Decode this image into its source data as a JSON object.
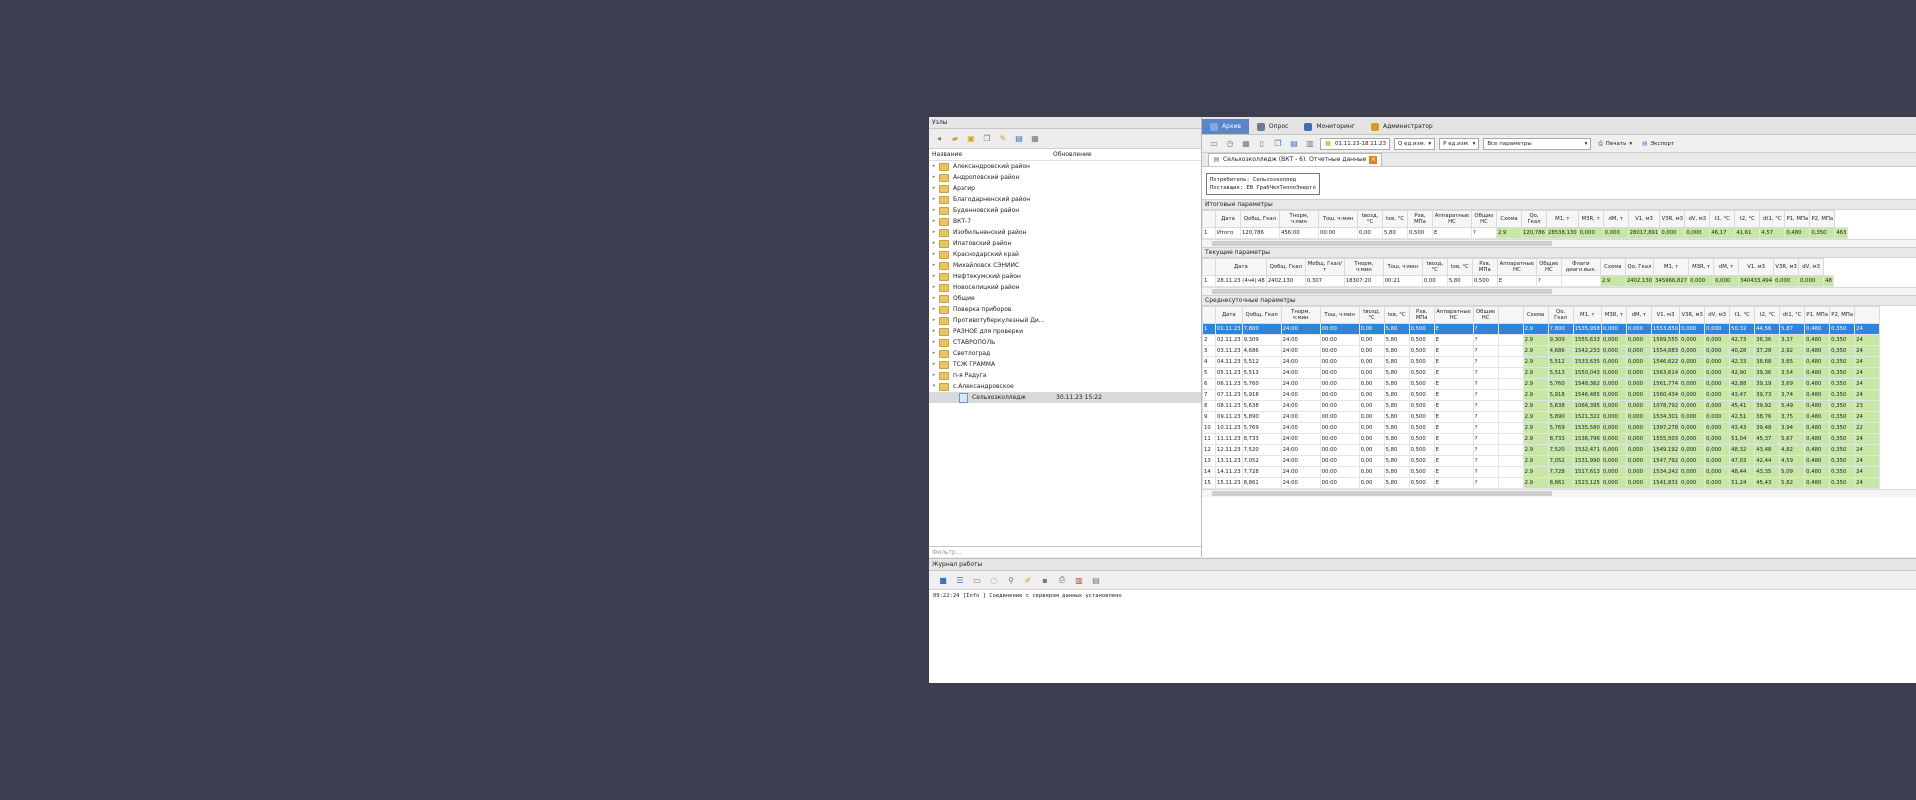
{
  "left_panel": {
    "title": "Узлы",
    "col_name": "Название",
    "col_updated": "Обновление",
    "filter_placeholder": "Фильтр...",
    "tree": [
      {
        "label": "Александровский район",
        "type": "folder",
        "expanded": false
      },
      {
        "label": "Андроповский район",
        "type": "folder",
        "expanded": false
      },
      {
        "label": "Арзгир",
        "type": "folder",
        "expanded": false
      },
      {
        "label": "Благодарненский район",
        "type": "folder",
        "expanded": false
      },
      {
        "label": "Буденновский район",
        "type": "folder",
        "expanded": false
      },
      {
        "label": "ВКТ-7",
        "type": "folder",
        "expanded": false
      },
      {
        "label": "Изобильненский район",
        "type": "folder",
        "expanded": false
      },
      {
        "label": "Ипатовский район",
        "type": "folder",
        "expanded": false
      },
      {
        "label": "Краснодарский край",
        "type": "folder",
        "expanded": false
      },
      {
        "label": "Михайловск СЭНИИС",
        "type": "folder",
        "expanded": false
      },
      {
        "label": "Нефтекумский район",
        "type": "folder",
        "expanded": false
      },
      {
        "label": "Новоселицкий район",
        "type": "folder",
        "expanded": false
      },
      {
        "label": "Общие",
        "type": "folder",
        "expanded": false
      },
      {
        "label": "Поверка приборов",
        "type": "folder",
        "expanded": false
      },
      {
        "label": "Противотуберкулезный Ди...",
        "type": "folder",
        "expanded": false
      },
      {
        "label": "РАЗНОЕ для проверки",
        "type": "folder",
        "expanded": false
      },
      {
        "label": "СТАВРОПОЛЬ",
        "type": "folder",
        "expanded": false
      },
      {
        "label": "Светлоград",
        "type": "folder",
        "expanded": false
      },
      {
        "label": "ТСЖ ГРАММА",
        "type": "folder",
        "expanded": false
      },
      {
        "label": "п-я Радуга",
        "type": "folder",
        "expanded": false
      },
      {
        "label": "с.Александровское",
        "type": "folder",
        "expanded": true
      },
      {
        "label": "Сельхозколледж",
        "type": "file",
        "updated": "30.11.23 15:22",
        "selected": true
      }
    ]
  },
  "tabs": [
    {
      "label": "Архив",
      "active": true,
      "color": "#7fa8e0"
    },
    {
      "label": "Опрос",
      "active": false,
      "color": "#6f7a8a"
    },
    {
      "label": "Мониторинг",
      "active": false,
      "color": "#3e6db3"
    },
    {
      "label": "Администратор",
      "active": false,
      "color": "#d4a017"
    }
  ],
  "toolbar": {
    "date_range": "01.11.23-18.11.23",
    "unit_q": "Q ед.изм.",
    "unit_p": "P ед.изм.",
    "params": "Все параметры",
    "print": "Печать",
    "export": "Экспорт"
  },
  "document_tab": "Сельхозколледж (ВКТ - 6). Отчетные данные",
  "info": {
    "line1": "Потребитель: Сельхозколлед",
    "line2": "Поставщик: ЕВ ГрабЧелТеплоЭнерго"
  },
  "totals": {
    "label": "Итоговые параметры",
    "headers": [
      "Дата",
      "Qобщ, Гкал",
      "Тнорм, ч:мин",
      "Тош, ч:мин",
      "tвозд, °C",
      "tхв, °C",
      "Pхв, МПа",
      "Аппаратные НС",
      "Общие НС",
      "Схема",
      "Qo, Гкал",
      "M1, т",
      "M3R, т",
      "dM, т",
      "V1, м3",
      "V3R, м3",
      "dV, м3",
      "t1, °C",
      "t2, °C",
      "dt1, °C",
      "P1, МПа",
      "P2, МПа"
    ],
    "rows": [
      [
        "1",
        "Итого",
        "120,786",
        "456:00",
        "00:00",
        "0,00",
        "5,80",
        "0,500",
        "E",
        "?",
        "2.9",
        "120,786",
        "28538,130",
        "0,000",
        "0,000",
        "28017,891",
        "0,000",
        "0,000",
        "46,17",
        "41,61",
        "4,57",
        "0,480",
        "0,350",
        "463"
      ]
    ]
  },
  "current": {
    "label": "Текущие параметры",
    "headers": [
      "Дата",
      "Qобщ, Гкал",
      "Мобщ, Гкал/т",
      "Тнорм, ч:мин",
      "Тош, ч:мин",
      "tвозд, °C",
      "tхв, °C",
      "Pхв, МПа",
      "Аппаратные НС",
      "Общие НС",
      "Флаги диагн.вых.",
      "Схема",
      "Qo, Гкал",
      "M1, т",
      "M3R, т",
      "dM, т",
      "V1, м3",
      "V3R, м3",
      "dV, м3"
    ],
    "rows": [
      [
        "1",
        "28.11.23 (4ч4):48",
        "2402,130",
        "0,307",
        "18307:20",
        "00:21",
        "0,00",
        "5,80",
        "0,500",
        "E",
        "?",
        "",
        "2.9",
        "2402,130",
        "345966,827",
        "0,000",
        "0,000",
        "340433,494",
        "0,000",
        "0,000",
        "48"
      ]
    ]
  },
  "daily": {
    "label": "Среднесуточные параметры",
    "headers": [
      "",
      "Дата",
      "Qобщ, Гкал",
      "Тнорм, ч:мин",
      "Тош, ч:мин",
      "tвозд, °C",
      "tхв, °C",
      "Pхв, МПа",
      "Аппаратные НС",
      "Общие НС",
      "",
      "Схема",
      "Qo, Гкал",
      "M1, т",
      "M3R, т",
      "dM, т",
      "V1, м3",
      "V3R, м3",
      "dV, м3",
      "t1, °C",
      "t2, °C",
      "dt1, °C",
      "P1, МПа",
      "P2, МПа",
      ""
    ],
    "rows": [
      [
        "1",
        "01.11.23",
        "7,800",
        "24:00",
        "00:00",
        "0,00",
        "5,80",
        "0,500",
        "E",
        "?",
        "",
        "2.9",
        "7,800",
        "1535,958",
        "0,000",
        "0,000",
        "1553,850",
        "0,000",
        "0,000",
        "50,32",
        "44,56",
        "5,87",
        "0,480",
        "0,350",
        "24"
      ],
      [
        "2",
        "02.11.23",
        "9,309",
        "24:00",
        "00:00",
        "0,00",
        "5,80",
        "0,500",
        "E",
        "?",
        "",
        "2.9",
        "9,309",
        "1555,633",
        "0,000",
        "0,000",
        "1569,555",
        "0,000",
        "0,000",
        "42,73",
        "36,36",
        "3,37",
        "0,480",
        "0,350",
        "24"
      ],
      [
        "3",
        "03.11.23",
        "4,686",
        "24:00",
        "00:00",
        "0,00",
        "5,80",
        "0,500",
        "E",
        "?",
        "",
        "2.9",
        "4,686",
        "1542,233",
        "0,000",
        "0,000",
        "1554,883",
        "0,000",
        "0,000",
        "40,28",
        "37,28",
        "2,92",
        "0,480",
        "0,350",
        "24"
      ],
      [
        "4",
        "04.11.23",
        "5,512",
        "24:00",
        "00:00",
        "0,00",
        "5,80",
        "0,500",
        "E",
        "?",
        "",
        "2.9",
        "5,512",
        "1533,635",
        "0,000",
        "0,000",
        "1546,622",
        "0,000",
        "0,000",
        "42,33",
        "38,68",
        "3,65",
        "0,480",
        "0,350",
        "24"
      ],
      [
        "5",
        "05.11.23",
        "5,513",
        "24:00",
        "00:00",
        "0,00",
        "5,80",
        "0,500",
        "E",
        "?",
        "",
        "2.9",
        "5,513",
        "1550,043",
        "0,000",
        "0,000",
        "1563,614",
        "0,000",
        "0,000",
        "42,90",
        "39,36",
        "3,54",
        "0,480",
        "0,350",
        "24"
      ],
      [
        "6",
        "06.11.23",
        "5,760",
        "24:00",
        "00:00",
        "0,00",
        "5,80",
        "0,500",
        "E",
        "?",
        "",
        "2.9",
        "5,760",
        "1548,362",
        "0,000",
        "0,000",
        "1561,774",
        "0,000",
        "0,000",
        "42,88",
        "39,19",
        "3,69",
        "0,480",
        "0,350",
        "24"
      ],
      [
        "7",
        "07.11.23",
        "5,918",
        "24:00",
        "00:00",
        "0,00",
        "5,80",
        "0,500",
        "E",
        "?",
        "",
        "2.9",
        "5,918",
        "1546,485",
        "0,000",
        "0,000",
        "1560,434",
        "0,000",
        "0,000",
        "43,47",
        "39,73",
        "3,74",
        "0,480",
        "0,350",
        "24"
      ],
      [
        "8",
        "08.11.23",
        "5,638",
        "24:00",
        "00:00",
        "0,00",
        "5,80",
        "0,500",
        "E",
        "?",
        "",
        "2.9",
        "5,638",
        "1066,395",
        "0,000",
        "0,000",
        "1078,792",
        "0,000",
        "0,000",
        "45,41",
        "39,92",
        "5,49",
        "0,480",
        "0,350",
        "23"
      ],
      [
        "9",
        "09.11.23",
        "5,890",
        "24:00",
        "00:00",
        "0,00",
        "5,80",
        "0,500",
        "E",
        "?",
        "",
        "2.9",
        "5,890",
        "1521,322",
        "0,000",
        "0,000",
        "1534,301",
        "0,000",
        "0,000",
        "42,51",
        "38,76",
        "3,75",
        "0,480",
        "0,350",
        "24"
      ],
      [
        "10",
        "10.11.23",
        "5,769",
        "24:00",
        "00:00",
        "0,00",
        "5,80",
        "0,500",
        "E",
        "?",
        "",
        "2.9",
        "5,769",
        "1535,580",
        "0,000",
        "0,000",
        "1397,278",
        "0,000",
        "0,000",
        "43,43",
        "39,48",
        "3,94",
        "0,480",
        "0,350",
        "22"
      ],
      [
        "11",
        "11.11.23",
        "8,733",
        "24:00",
        "00:00",
        "0,00",
        "5,80",
        "0,500",
        "E",
        "?",
        "",
        "2.9",
        "8,733",
        "1536,796",
        "0,000",
        "0,000",
        "1555,503",
        "0,000",
        "0,000",
        "51,04",
        "45,37",
        "5,67",
        "0,480",
        "0,350",
        "24"
      ],
      [
        "12",
        "12.11.23",
        "7,520",
        "24:00",
        "00:00",
        "0,00",
        "5,80",
        "0,500",
        "E",
        "?",
        "",
        "2.9",
        "7,520",
        "1532,471",
        "0,000",
        "0,000",
        "1549,192",
        "0,000",
        "0,000",
        "48,32",
        "43,48",
        "4,82",
        "0,480",
        "0,350",
        "24"
      ],
      [
        "13",
        "13.11.23",
        "7,052",
        "24:00",
        "00:00",
        "0,00",
        "5,80",
        "0,500",
        "E",
        "?",
        "",
        "2.9",
        "7,052",
        "1531,990",
        "0,000",
        "0,000",
        "1547,792",
        "0,000",
        "0,000",
        "47,03",
        "42,44",
        "4,59",
        "0,480",
        "0,350",
        "24"
      ],
      [
        "14",
        "14.11.23",
        "7,728",
        "24:00",
        "00:00",
        "0,00",
        "5,80",
        "0,500",
        "E",
        "?",
        "",
        "2.9",
        "7,728",
        "1517,613",
        "0,000",
        "0,000",
        "1534,242",
        "0,000",
        "0,000",
        "48,44",
        "43,35",
        "5,09",
        "0,480",
        "0,350",
        "24"
      ],
      [
        "15",
        "15.11.23",
        "8,861",
        "24:00",
        "00:00",
        "0,00",
        "5,80",
        "0,500",
        "E",
        "?",
        "",
        "2.9",
        "8,861",
        "1523,125",
        "0,000",
        "0,000",
        "1541,831",
        "0,000",
        "0,000",
        "51,24",
        "45,43",
        "5,82",
        "0,480",
        "0,350",
        "24"
      ]
    ]
  },
  "journal": {
    "title": "Журнал работы",
    "line": "09:22:24  [Info    ]  Соединение с сервером данных установлено"
  }
}
